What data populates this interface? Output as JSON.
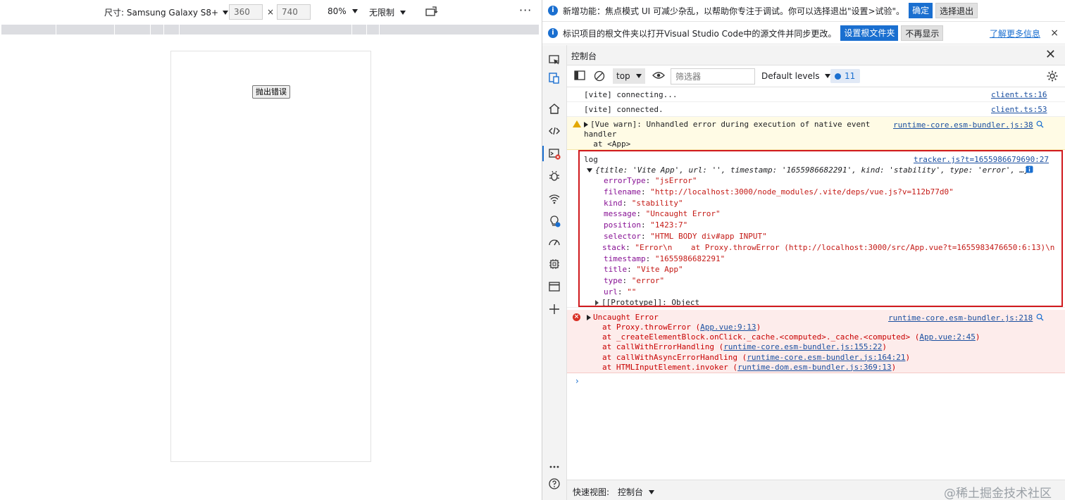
{
  "emulation": {
    "device_label": "尺寸: Samsung Galaxy S8+",
    "width": "360",
    "height": "740",
    "x_sep": "×",
    "zoom": "80%",
    "throttle": "无限制",
    "more": "···",
    "page_button": "抛出错误"
  },
  "info_bars": [
    {
      "message": "新增功能：焦点模式 UI 可减少杂乱，以帮助你专注于调试。你可以选择退出\"设置>试验\"。",
      "primary": "确定",
      "secondary": "选择退出"
    },
    {
      "message": "标识项目的根文件夹以打开Visual Studio Code中的源文件并同步更改。",
      "primary": "设置根文件夹",
      "secondary": "不再显示",
      "link": "了解更多信息",
      "close": "×"
    }
  ],
  "console": {
    "title": "控制台",
    "context": "top",
    "filter_placeholder": "筛选器",
    "levels": "Default levels",
    "issues_count": "11",
    "prompt": "›"
  },
  "messages": {
    "vite_connecting": {
      "text": "[vite] connecting...",
      "source": "client.ts:16"
    },
    "vite_connected": {
      "text": "[vite] connected.",
      "source": "client.ts:53"
    },
    "vue_warn": {
      "line1": "[Vue warn]: Unhandled error during execution of native event",
      "line2": "handler",
      "line3": "  at <App>",
      "source": "runtime-core.esm-bundler.js:38"
    },
    "log": {
      "label": "log",
      "source": "tracker.js?t=1655986679690:27",
      "summary": "{title: 'Vite App', url: '', timestamp: '1655986682291', kind: 'stability', type: 'error', …}",
      "props": [
        {
          "key": "errorType",
          "value": "\"jsError\""
        },
        {
          "key": "filename",
          "value": "\"http://localhost:3000/node_modules/.vite/deps/vue.js?v=112b77d0\""
        },
        {
          "key": "kind",
          "value": "\"stability\""
        },
        {
          "key": "message",
          "value": "\"Uncaught Error\""
        },
        {
          "key": "position",
          "value": "\"1423:7\""
        },
        {
          "key": "selector",
          "value": "\"HTML BODY div#app INPUT\""
        },
        {
          "key": "stack",
          "value": "\"Error\\n    at Proxy.throwError (http://localhost:3000/src/App.vue?t=1655983476650:6:13)\\n"
        },
        {
          "key": "timestamp",
          "value": "\"1655986682291\""
        },
        {
          "key": "title",
          "value": "\"Vite App\""
        },
        {
          "key": "type",
          "value": "\"error\""
        },
        {
          "key": "url",
          "value": "\"\""
        }
      ],
      "prototype": "[[Prototype]]: Object"
    },
    "uncaught": {
      "title": "Uncaught Error",
      "source": "runtime-core.esm-bundler.js:218",
      "frames": [
        {
          "pre": "at Proxy.throwError (",
          "link": "App.vue:9:13",
          "post": ")"
        },
        {
          "pre": "at _createElementBlock.onClick._cache.<computed>._cache.<computed> (",
          "link": "App.vue:2:45",
          "post": ")"
        },
        {
          "pre": "at callWithErrorHandling (",
          "link": "runtime-core.esm-bundler.js:155:22",
          "post": ")"
        },
        {
          "pre": "at callWithAsyncErrorHandling (",
          "link": "runtime-core.esm-bundler.js:164:21",
          "post": ")"
        },
        {
          "pre": "at HTMLInputElement.invoker (",
          "link": "runtime-dom.esm-bundler.js:369:13",
          "post": ")"
        }
      ]
    }
  },
  "drawer": {
    "label": "快速视图:",
    "selected": "控制台"
  },
  "watermark": "@稀土掘金技术社区",
  "colors": {
    "accent": "#1a6fd0",
    "error_bg": "#fdeceb",
    "warn_bg": "#fffbe5",
    "highlight_border": "#d0191d"
  }
}
